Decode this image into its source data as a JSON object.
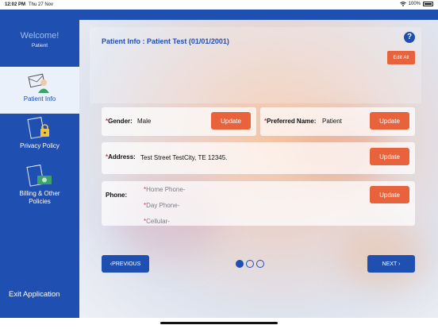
{
  "status": {
    "time": "12:02 PM",
    "date": "Thu 27 Nov",
    "battery": "100%"
  },
  "sidebar": {
    "welcome": "Welcome!",
    "role": "Patient",
    "items": [
      {
        "label": "Patient Info",
        "icon": "user-mail-icon",
        "active": true
      },
      {
        "label": "Privacy Policy",
        "icon": "lock-document-icon",
        "active": false
      },
      {
        "label": "Billing & Other Policies",
        "icon": "money-document-icon",
        "active": false
      }
    ],
    "exit": "Exit Application"
  },
  "header": {
    "title": "Patient Info : Patient Test (01/01/2001)",
    "help": "?",
    "edit_all": "Edit All"
  },
  "fields": {
    "required_mark": "*",
    "gender": {
      "label": "Gender:",
      "value": "Male",
      "button": "Update"
    },
    "preferred_name": {
      "label": "Preferred Name:",
      "value": "Patient",
      "button": "Update"
    },
    "address": {
      "label": "Address:",
      "value": "Test Street TestCity, TE 12345.",
      "button": "Update"
    },
    "phone": {
      "label": "Phone:",
      "home": "Home Phone-",
      "day": "Day Phone-",
      "cell": "Cellular-",
      "button": "Update"
    }
  },
  "pagination": {
    "previous": "PREVIOUS",
    "next": "NEXT",
    "prev_arrow": "‹",
    "next_arrow": "›",
    "pages": 3,
    "current": 1
  },
  "colors": {
    "primary": "#1f4fb0",
    "accent": "#e8623b",
    "required": "#e8304a"
  }
}
